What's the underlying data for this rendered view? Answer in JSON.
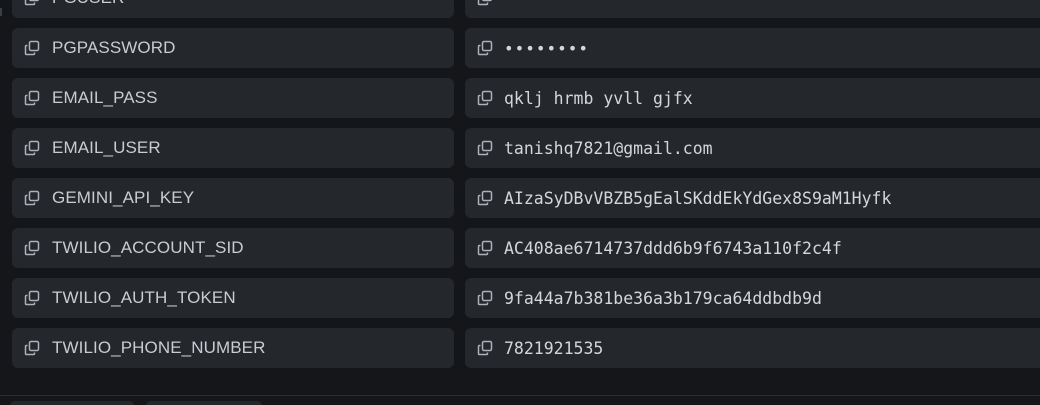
{
  "icons": {
    "copy": "copy-icon"
  },
  "colors": {
    "background": "#141619",
    "cell": "#24272c",
    "key_text": "#c9ccd1",
    "value_text": "#d4d6da",
    "icon": "#aeb2b8"
  },
  "env_vars": [
    {
      "key": "PGUSER",
      "value": ""
    },
    {
      "key": "PGPASSWORD",
      "value": "••••••••"
    },
    {
      "key": "EMAIL_PASS",
      "value": "qklj hrmb yvll gjfx"
    },
    {
      "key": "EMAIL_USER",
      "value": "tanishq7821@gmail.com"
    },
    {
      "key": "GEMINI_API_KEY",
      "value": "AIzaSyDBvVBZB5gEalSKddEkYdGex8S9aM1Hyfk"
    },
    {
      "key": "TWILIO_ACCOUNT_SID",
      "value": "AC408ae6714737ddd6b9f6743a110f2c4f"
    },
    {
      "key": "TWILIO_AUTH_TOKEN",
      "value": "9fa44a7b381be36a3b179ca64ddbdb9d"
    },
    {
      "key": "TWILIO_PHONE_NUMBER",
      "value": "7821921535"
    }
  ]
}
